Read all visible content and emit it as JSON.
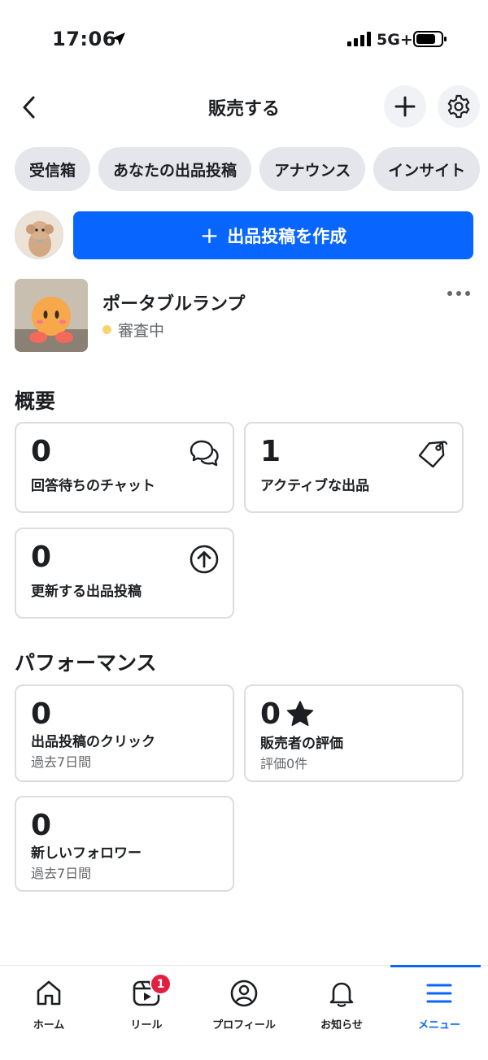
{
  "status_bar": {
    "time": "17:06",
    "network": "5G+"
  },
  "header": {
    "title": "販売する"
  },
  "tabs": [
    "受信箱",
    "あなたの出品投稿",
    "アナウンス",
    "インサイト"
  ],
  "create_button": {
    "label": "出品投稿を作成"
  },
  "listing": {
    "title": "ポータブルランプ",
    "status": "審査中"
  },
  "overview": {
    "title": "概要",
    "cards": [
      {
        "value": "0",
        "label": "回答待ちのチャット"
      },
      {
        "value": "1",
        "label": "アクティブな出品"
      },
      {
        "value": "0",
        "label": "更新する出品投稿"
      }
    ]
  },
  "performance": {
    "title": "パフォーマンス",
    "cards": [
      {
        "value": "0",
        "label": "出品投稿のクリック",
        "sub": "過去7日間"
      },
      {
        "value": "0",
        "label": "販売者の評価",
        "sub": "評価0件"
      },
      {
        "value": "0",
        "label": "新しいフォロワー",
        "sub": "過去7日間"
      }
    ]
  },
  "bottom_nav": {
    "items": [
      {
        "label": "ホーム",
        "icon": "home-icon"
      },
      {
        "label": "リール",
        "icon": "reels-icon"
      },
      {
        "label": "プロフィール",
        "icon": "profile-icon"
      },
      {
        "label": "お知らせ",
        "icon": "bell-icon"
      },
      {
        "label": "メニュー",
        "icon": "menu-icon"
      }
    ],
    "reels_badge": "1",
    "active": "メニュー"
  },
  "colors": {
    "accent": "#0866ff",
    "badge": "#e41e3f",
    "pending_dot": "#f7d46c",
    "chip_bg": "#e4e6eb"
  }
}
